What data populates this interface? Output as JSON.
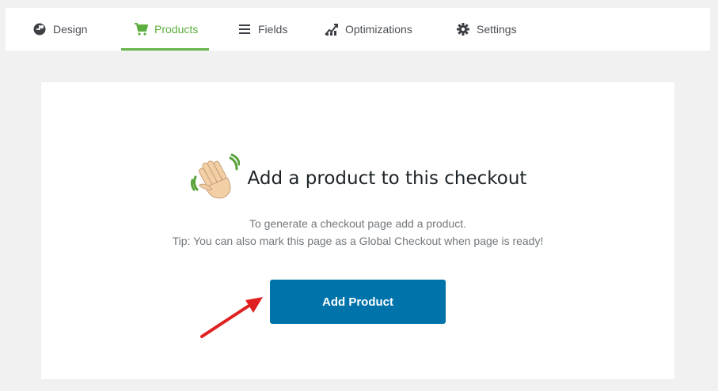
{
  "tabs": [
    {
      "label": "Design",
      "icon": "palette-icon"
    },
    {
      "label": "Products",
      "icon": "cart-icon",
      "active": true
    },
    {
      "label": "Fields",
      "icon": "list-icon"
    },
    {
      "label": "Optimizations",
      "icon": "chart-icon"
    },
    {
      "label": "Settings",
      "icon": "gear-icon"
    }
  ],
  "empty_state": {
    "icon": "waving-hand-icon",
    "title": "Add a product to this checkout",
    "line1": "To generate a checkout page add a product.",
    "line2": "Tip: You can also mark this page as a Global Checkout when page is ready!",
    "button_label": "Add Product"
  },
  "colors": {
    "accent_green": "#67b54a",
    "button_blue": "#0073aa",
    "annotation_red": "#e02020"
  }
}
